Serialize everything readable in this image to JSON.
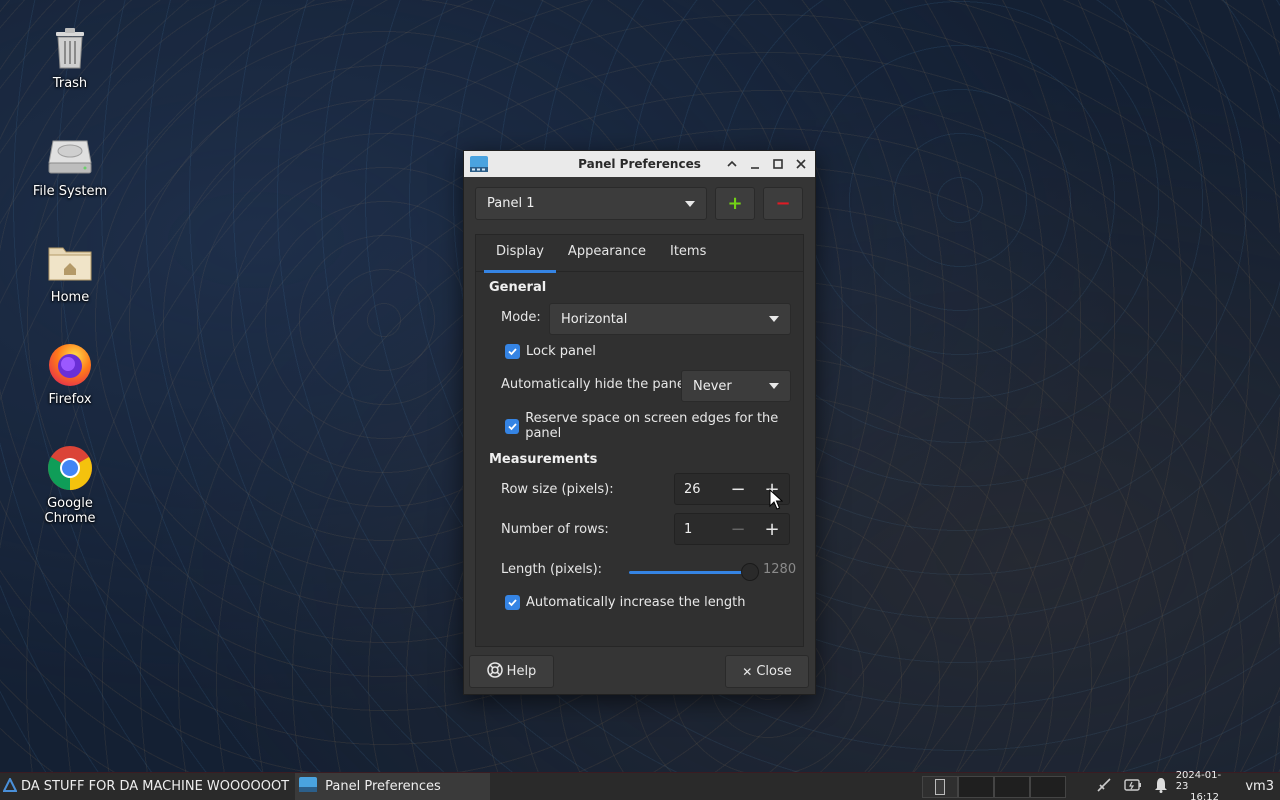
{
  "desktop": {
    "icons": [
      {
        "label": "Trash",
        "icon": "trash-icon"
      },
      {
        "label": "File System",
        "icon": "drive-icon"
      },
      {
        "label": "Home",
        "icon": "home-folder-icon"
      },
      {
        "label": "Firefox",
        "icon": "firefox-icon"
      },
      {
        "label": "Google Chrome",
        "icon": "chrome-icon"
      }
    ]
  },
  "window": {
    "title": "Panel Preferences",
    "panel_select": {
      "value": "Panel 1"
    },
    "add_label": "+",
    "remove_label": "−",
    "tabs": [
      {
        "label": "Display",
        "active": true
      },
      {
        "label": "Appearance",
        "active": false
      },
      {
        "label": "Items",
        "active": false
      }
    ],
    "general": {
      "heading": "General",
      "mode_label": "Mode:",
      "mode_value": "Horizontal",
      "lock_panel": {
        "label": "Lock panel",
        "checked": true
      },
      "autohide_label": "Automatically hide the panel:",
      "autohide_value": "Never",
      "reserve_space": {
        "label": "Reserve space on screen edges for the panel",
        "checked": true
      }
    },
    "measurements": {
      "heading": "Measurements",
      "row_size_label": "Row size (pixels):",
      "row_size_value": "26",
      "rows_label": "Number of rows:",
      "rows_value": "1",
      "length_label": "Length (pixels):",
      "length_value": "1280",
      "length_fraction": 1.0,
      "auto_length": {
        "label": "Automatically increase the length",
        "checked": true
      }
    },
    "help_label": "Help",
    "close_label": "Close"
  },
  "taskbar": {
    "launcher_label": "DA STUFF FOR DA MACHINE WOOOOOOT",
    "task_label": "Panel Preferences",
    "date": "2024-01-23",
    "time": "16:12",
    "user": "vm3"
  },
  "colors": {
    "accent": "#3584e4",
    "add_green": "#73d216",
    "remove_red": "#e01b24"
  }
}
